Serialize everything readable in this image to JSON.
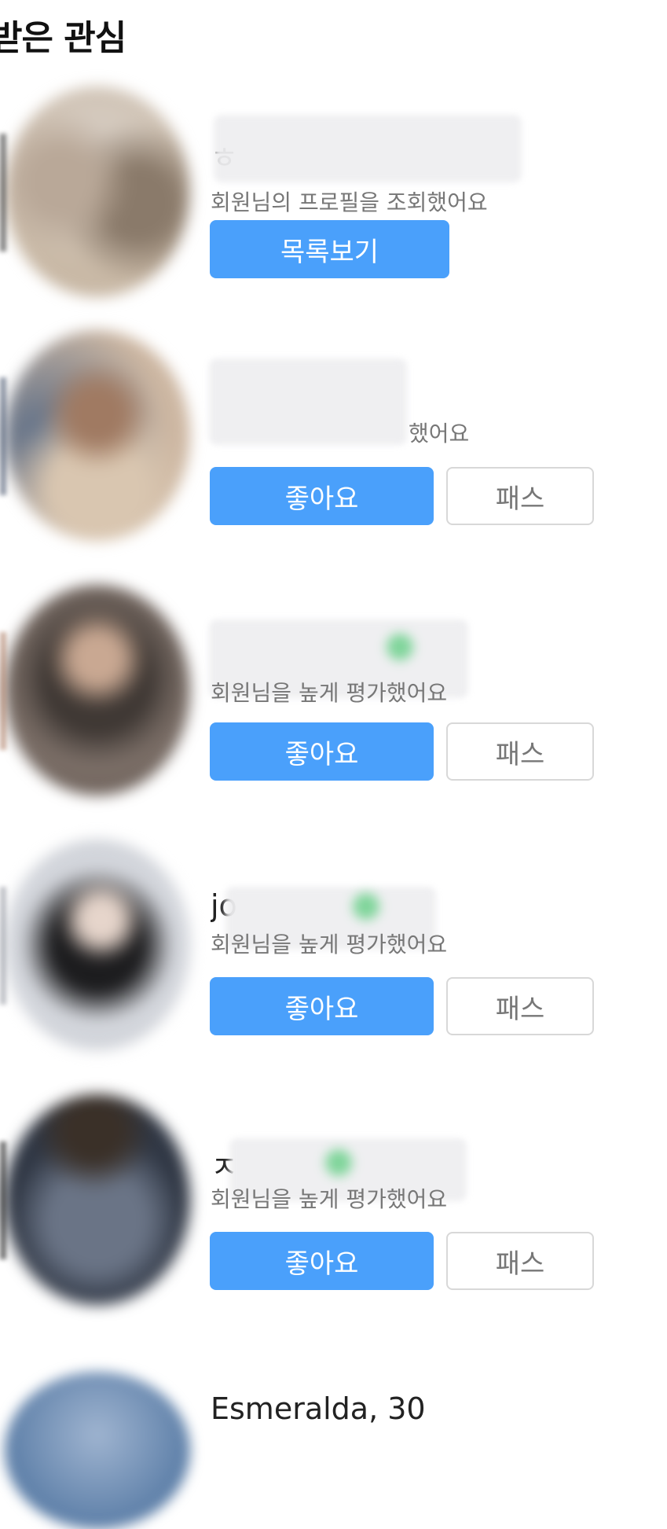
{
  "header": {
    "title": "받은 관심"
  },
  "cards": [
    {
      "name_visible": "ㅎ",
      "message": "회원님의 프로필을 조회했어요",
      "primary_button": "목록보기",
      "avatar_colors": [
        "#d8cfc6",
        "#8a7a6a",
        "#c9b9a6"
      ]
    },
    {
      "name_visible": "",
      "message": "했어요",
      "primary_button": "좋아요",
      "secondary_button": "패스",
      "avatar_colors": [
        "#cdb7a2",
        "#7a6252",
        "#5a6c86"
      ]
    },
    {
      "name_visible": "",
      "message": "회원님을 높게 평가했어요",
      "primary_button": "좋아요",
      "secondary_button": "패스",
      "avatar_colors": [
        "#a8988f",
        "#3f3834",
        "#8c7b73"
      ]
    },
    {
      "name_visible": "jo",
      "message": "회원님을 높게 평가했어요",
      "primary_button": "좋아요",
      "secondary_button": "패스",
      "avatar_colors": [
        "#e6e8ee",
        "#1c1c1e",
        "#cfd2d8"
      ]
    },
    {
      "name_visible": "ㅈ",
      "message": "회원님을 높게 평가했어요",
      "primary_button": "좋아요",
      "secondary_button": "패스",
      "avatar_colors": [
        "#3e4654",
        "#6a7486",
        "#2c3340"
      ]
    }
  ],
  "next_card": {
    "name": "Esmeralda, 30"
  },
  "colors": {
    "primary": "#4aa0fb",
    "online_dot": "#7fd59a"
  }
}
